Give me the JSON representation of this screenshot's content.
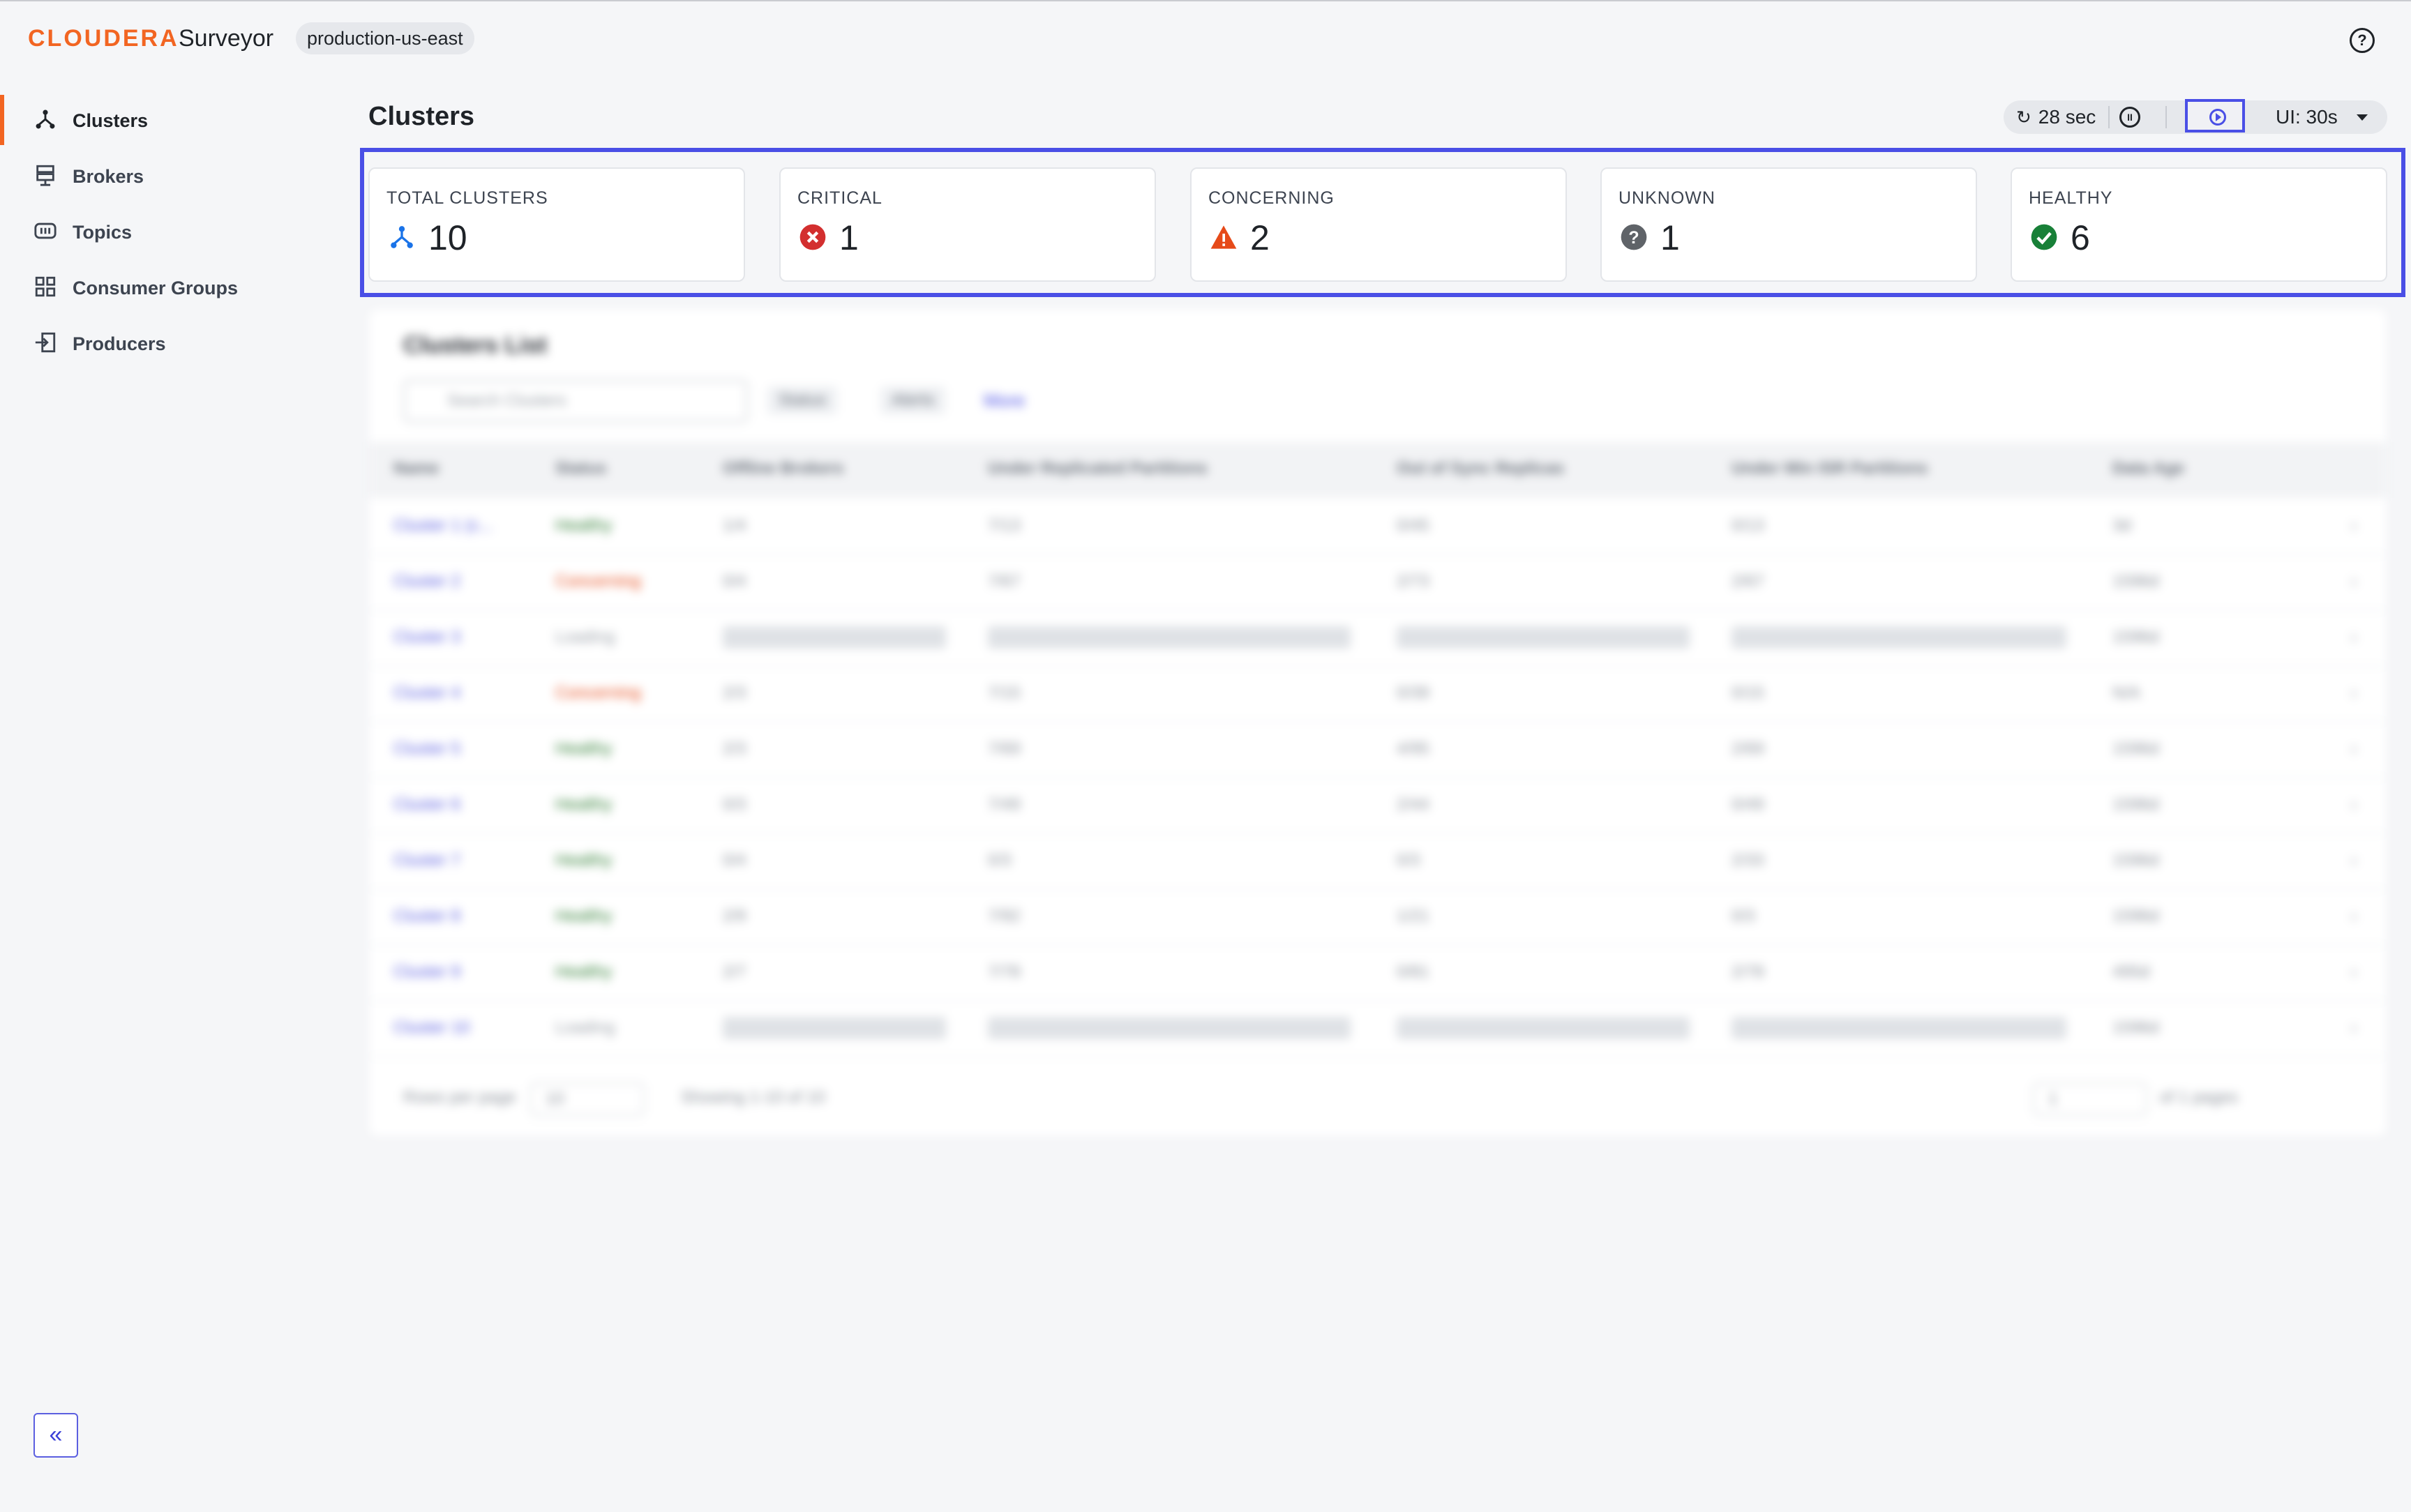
{
  "app": {
    "logo_text": "CLOUDERA",
    "product_name": "Surveyor",
    "environment": "production-us-east",
    "help_label": "?"
  },
  "sidebar": {
    "items": [
      {
        "label": "Clusters",
        "icon": "clusters-icon",
        "active": true
      },
      {
        "label": "Brokers",
        "icon": "brokers-icon",
        "active": false
      },
      {
        "label": "Topics",
        "icon": "topics-icon",
        "active": false
      },
      {
        "label": "Consumer Groups",
        "icon": "consumer-groups-icon",
        "active": false
      },
      {
        "label": "Producers",
        "icon": "producers-icon",
        "active": false
      }
    ],
    "collapse_label": "«"
  },
  "page": {
    "title": "Clusters"
  },
  "toolbar": {
    "refresh_label": "28 sec",
    "ui_interval_label": "UI: 30s"
  },
  "summary": {
    "total": {
      "label": "TOTAL CLUSTERS",
      "value": "10",
      "icon": "clusters-icon",
      "color": "#1a73e8"
    },
    "critical": {
      "label": "CRITICAL",
      "value": "1",
      "icon": "error-icon",
      "color": "#d32f2f"
    },
    "concerning": {
      "label": "CONCERNING",
      "value": "2",
      "icon": "warning-icon",
      "color": "#e64a19"
    },
    "unknown": {
      "label": "UNKNOWN",
      "value": "1",
      "icon": "help-circle-icon",
      "color": "#5f6368"
    },
    "healthy": {
      "label": "HEALTHY",
      "value": "6",
      "icon": "check-circle-icon",
      "color": "#188038"
    }
  },
  "clusters_list": {
    "title": "Clusters List",
    "search_placeholder": "Search Clusters",
    "filters": [
      "Status",
      "Alerts"
    ],
    "more_label": "More",
    "columns": [
      "Name",
      "Status",
      "Offline Brokers",
      "Under Replicated Partitions",
      "Out of Sync Replicas",
      "Under Min ISR Partitions",
      "Data Age"
    ],
    "rows": [
      {
        "name": "Cluster 1 (c...",
        "status": "Healthy",
        "offline": "1/4",
        "urp": "7/13",
        "oosr": "0/45",
        "umisr": "0/13",
        "age": "3d"
      },
      {
        "name": "Cluster 2",
        "status": "Concerning",
        "offline": "0/4",
        "urp": "7/67",
        "oosr": "2/73",
        "umisr": "2/67",
        "age": "1596d"
      },
      {
        "name": "Cluster 3",
        "status": "Loading",
        "offline": "",
        "urp": "",
        "oosr": "",
        "umisr": "",
        "age": "1596d"
      },
      {
        "name": "Cluster 4",
        "status": "Concerning",
        "offline": "2/3",
        "urp": "7/15",
        "oosr": "0/39",
        "umisr": "0/15",
        "age": "N/A"
      },
      {
        "name": "Cluster 5",
        "status": "Healthy",
        "offline": "2/3",
        "urp": "7/69",
        "oosr": "4/95",
        "umisr": "2/69",
        "age": "1596d"
      },
      {
        "name": "Cluster 6",
        "status": "Healthy",
        "offline": "0/3",
        "urp": "7/49",
        "oosr": "2/44",
        "umisr": "0/49",
        "age": "1596d"
      },
      {
        "name": "Cluster 7",
        "status": "Healthy",
        "offline": "0/4",
        "urp": "0/3",
        "oosr": "0/3",
        "umisr": "2/33",
        "age": "1596d"
      },
      {
        "name": "Cluster 8",
        "status": "Healthy",
        "offline": "2/9",
        "urp": "7/92",
        "oosr": "1/21",
        "umisr": "0/3",
        "age": "1596d"
      },
      {
        "name": "Cluster 9",
        "status": "Healthy",
        "offline": "2/7",
        "urp": "7/78",
        "oosr": "0/81",
        "umisr": "2/78",
        "age": "495d"
      },
      {
        "name": "Cluster 10",
        "status": "Loading",
        "offline": "",
        "urp": "",
        "oosr": "",
        "umisr": "",
        "age": "1596d"
      }
    ],
    "pagination": {
      "rows_per_page_label": "Rows per page",
      "rows_per_page_value": "10",
      "showing": "Showing 1-10 of 10",
      "page_value": "1",
      "of_pages": "of 1 pages"
    }
  }
}
